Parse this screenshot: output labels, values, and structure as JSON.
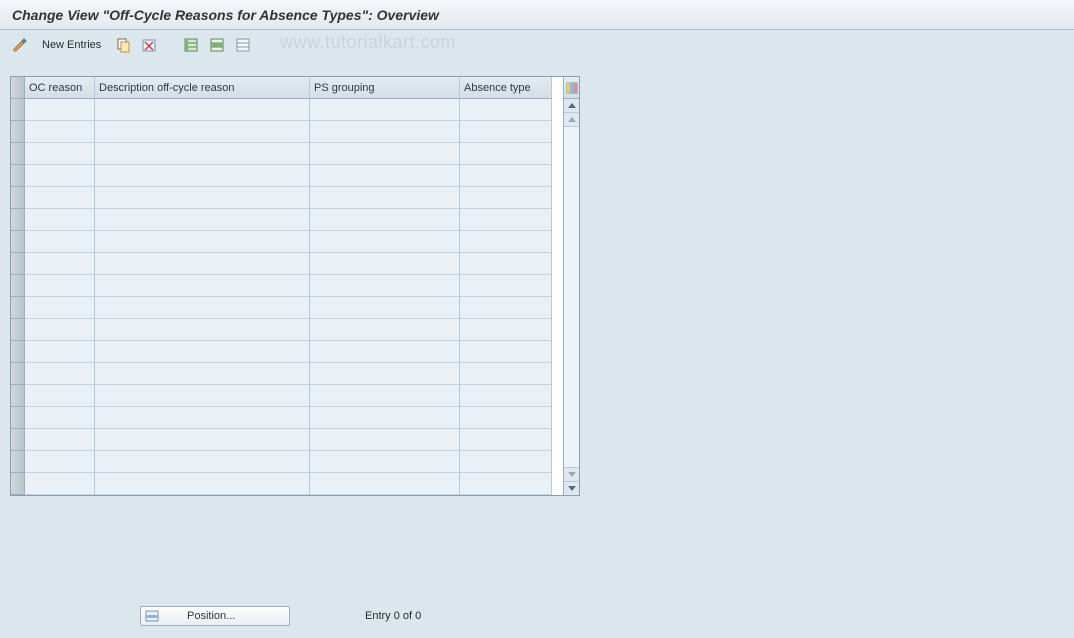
{
  "title": "Change View \"Off-Cycle Reasons for Absence Types\": Overview",
  "toolbar": {
    "new_entries_label": "New Entries"
  },
  "watermark": "www.tutorialkart.com",
  "table": {
    "columns": {
      "oc_reason": "OC reason",
      "description": "Description off-cycle reason",
      "ps_grouping": "PS grouping",
      "absence_type": "Absence type"
    },
    "rows": [
      {
        "oc_reason": "",
        "description": "",
        "ps_grouping": "",
        "absence_type": ""
      },
      {
        "oc_reason": "",
        "description": "",
        "ps_grouping": "",
        "absence_type": ""
      },
      {
        "oc_reason": "",
        "description": "",
        "ps_grouping": "",
        "absence_type": ""
      },
      {
        "oc_reason": "",
        "description": "",
        "ps_grouping": "",
        "absence_type": ""
      },
      {
        "oc_reason": "",
        "description": "",
        "ps_grouping": "",
        "absence_type": ""
      },
      {
        "oc_reason": "",
        "description": "",
        "ps_grouping": "",
        "absence_type": ""
      },
      {
        "oc_reason": "",
        "description": "",
        "ps_grouping": "",
        "absence_type": ""
      },
      {
        "oc_reason": "",
        "description": "",
        "ps_grouping": "",
        "absence_type": ""
      },
      {
        "oc_reason": "",
        "description": "",
        "ps_grouping": "",
        "absence_type": ""
      },
      {
        "oc_reason": "",
        "description": "",
        "ps_grouping": "",
        "absence_type": ""
      },
      {
        "oc_reason": "",
        "description": "",
        "ps_grouping": "",
        "absence_type": ""
      },
      {
        "oc_reason": "",
        "description": "",
        "ps_grouping": "",
        "absence_type": ""
      },
      {
        "oc_reason": "",
        "description": "",
        "ps_grouping": "",
        "absence_type": ""
      },
      {
        "oc_reason": "",
        "description": "",
        "ps_grouping": "",
        "absence_type": ""
      },
      {
        "oc_reason": "",
        "description": "",
        "ps_grouping": "",
        "absence_type": ""
      },
      {
        "oc_reason": "",
        "description": "",
        "ps_grouping": "",
        "absence_type": ""
      },
      {
        "oc_reason": "",
        "description": "",
        "ps_grouping": "",
        "absence_type": ""
      },
      {
        "oc_reason": "",
        "description": "",
        "ps_grouping": "",
        "absence_type": ""
      }
    ]
  },
  "footer": {
    "position_label": "Position...",
    "entry_text": "Entry 0 of 0"
  }
}
